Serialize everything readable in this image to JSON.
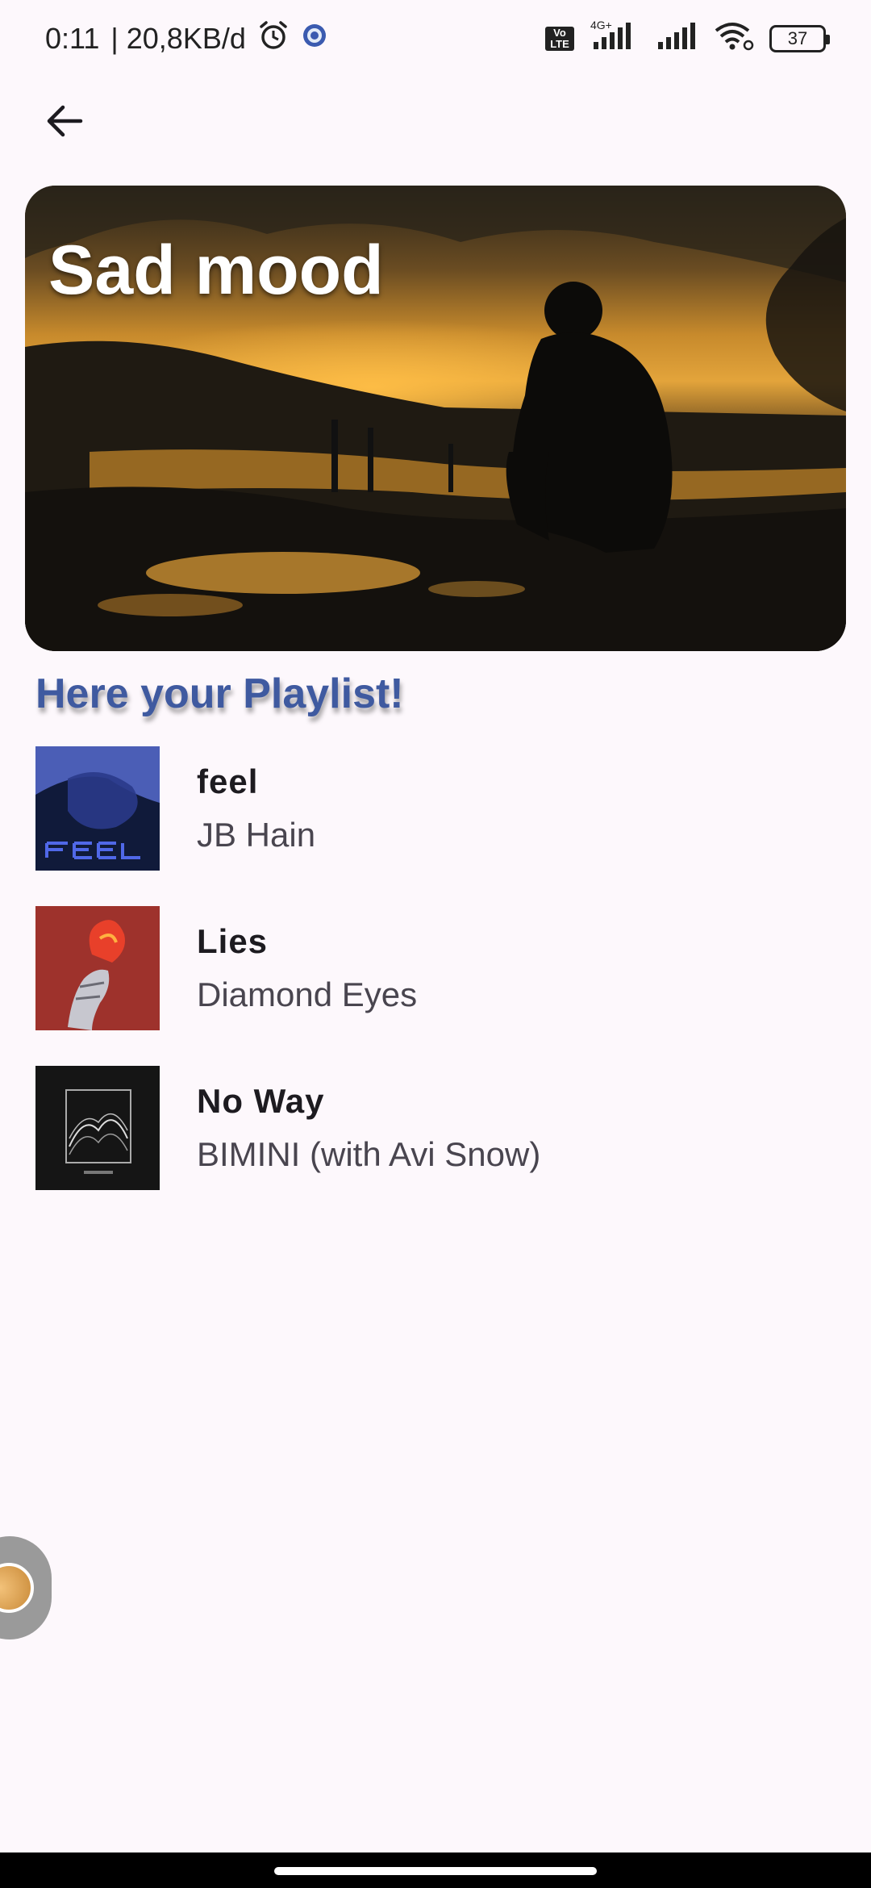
{
  "status_bar": {
    "time": "0:11",
    "speed": "| 20,8KB/d",
    "network_type": "4G+",
    "volte_label": "Vo LTE",
    "battery_level": "37",
    "icons": [
      "alarm-icon",
      "vpn-icon",
      "volte-icon",
      "signal-icon",
      "signal-icon",
      "wifi-icon",
      "battery-icon"
    ]
  },
  "header": {
    "back_icon": "arrow-left-icon"
  },
  "hero": {
    "title": "Sad mood"
  },
  "section": {
    "title": "Here your Playlist!"
  },
  "tracks": [
    {
      "title": "feel",
      "artist": "JB Hain"
    },
    {
      "title": "Lies",
      "artist": "Diamond Eyes"
    },
    {
      "title": "No Way",
      "artist": "BIMINI (with Avi Snow)"
    }
  ],
  "colors": {
    "background": "#fdf8fc",
    "section_title": "#3f5aa0",
    "title_text": "#1d1b20",
    "artist_text": "#49454f"
  }
}
